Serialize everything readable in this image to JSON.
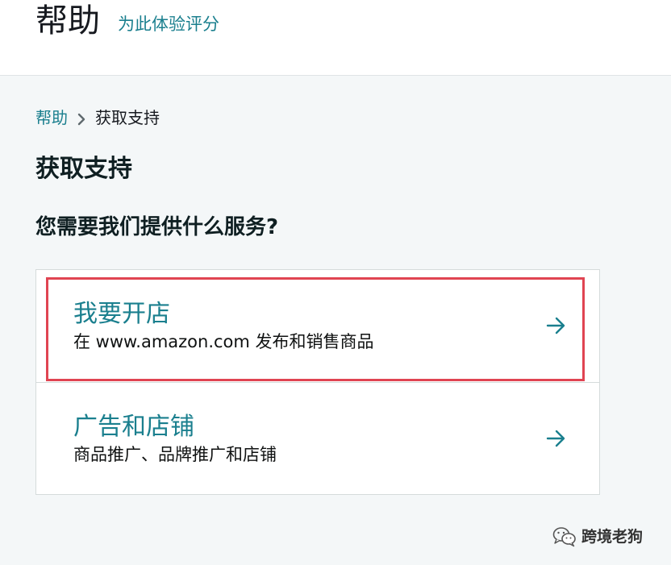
{
  "header": {
    "title": "帮助",
    "rate_link": "为此体验评分"
  },
  "breadcrumb": {
    "home": "帮助",
    "separator_icon": "chevron-right-icon",
    "current": "获取支持"
  },
  "page": {
    "title": "获取支持",
    "question": "您需要我们提供什么服务?"
  },
  "options": [
    {
      "title": "我要开店",
      "description": "在 www.amazon.com 发布和销售商品",
      "icon": "arrow-right-icon"
    },
    {
      "title": "广告和店铺",
      "description": "商品推广、品牌推广和店铺",
      "icon": "arrow-right-icon"
    }
  ],
  "watermark": {
    "text": "跨境老狗",
    "icon": "wechat-icon"
  },
  "colors": {
    "link": "#1a7f8e",
    "background": "#f4f7f8",
    "highlight": "#e04452"
  }
}
